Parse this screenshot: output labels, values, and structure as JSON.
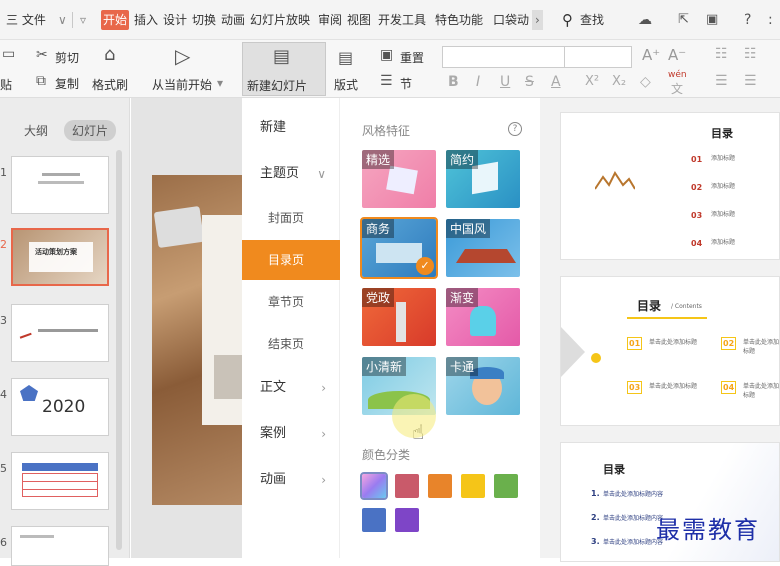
{
  "menubar": {
    "items": [
      "三 文件",
      "开始",
      "插入",
      "设计",
      "切换",
      "动画",
      "幻灯片放映",
      "审阅",
      "视图",
      "开发工具",
      "特色功能",
      "口袋动"
    ],
    "search": "查找",
    "help": "?",
    "more": ":",
    "overflow": "›"
  },
  "toolbar": {
    "cut": "剪切",
    "copy": "复制",
    "paste": "贴",
    "format_painter": "格式刷",
    "from_current": "从当前开始",
    "new_slide": "新建幻灯片",
    "layout": "版式",
    "reset": "重置",
    "section": "节",
    "font_size_up": "A⁺",
    "font_size_down": "A⁻",
    "bold": "B",
    "italic": "I",
    "underline": "U",
    "strike": "S",
    "font_color": "A",
    "superscript": "X²",
    "subscript": "X₂",
    "eraser": "◇",
    "phonetic": "wén",
    "phonetic_char": "文"
  },
  "left_panel": {
    "tab_outline": "大纲",
    "tab_slides": "幻灯片",
    "numbers": [
      "1",
      "2",
      "3",
      "4",
      "5",
      "6"
    ],
    "thumb2_text": "活动策划方案",
    "thumb4_text": "2020"
  },
  "categories": {
    "new": "新建",
    "theme": "主题页",
    "cover": "封面页",
    "toc": "目录页",
    "chapter": "章节页",
    "ending": "结束页",
    "body": "正文",
    "case": "案例",
    "animation": "动画"
  },
  "styles": {
    "header": "风格特征",
    "tiles": [
      "精选",
      "简约",
      "商务",
      "中国风",
      "党政",
      "渐变",
      "小清新",
      "卡通"
    ],
    "color_header": "颜色分类",
    "colors": [
      "#c95a6a",
      "#e8842a",
      "#f5c518",
      "#6ab04c",
      "#4a72c4",
      "#7e45c7"
    ]
  },
  "previews": {
    "p1_title": "目录",
    "p1_nums": [
      "01",
      "02",
      "03",
      "04"
    ],
    "p1_item": "添加标题",
    "p2_title": "目录",
    "p2_sub": "/ Contents",
    "p2_nums": [
      "01",
      "02",
      "03",
      "04"
    ],
    "p2_item": "单击此处添加标题",
    "p3_title": "目录",
    "p3_nums": [
      "1.",
      "2.",
      "3."
    ],
    "p3_item": "单击此处添加标题内容"
  },
  "watermark": "最需教育"
}
